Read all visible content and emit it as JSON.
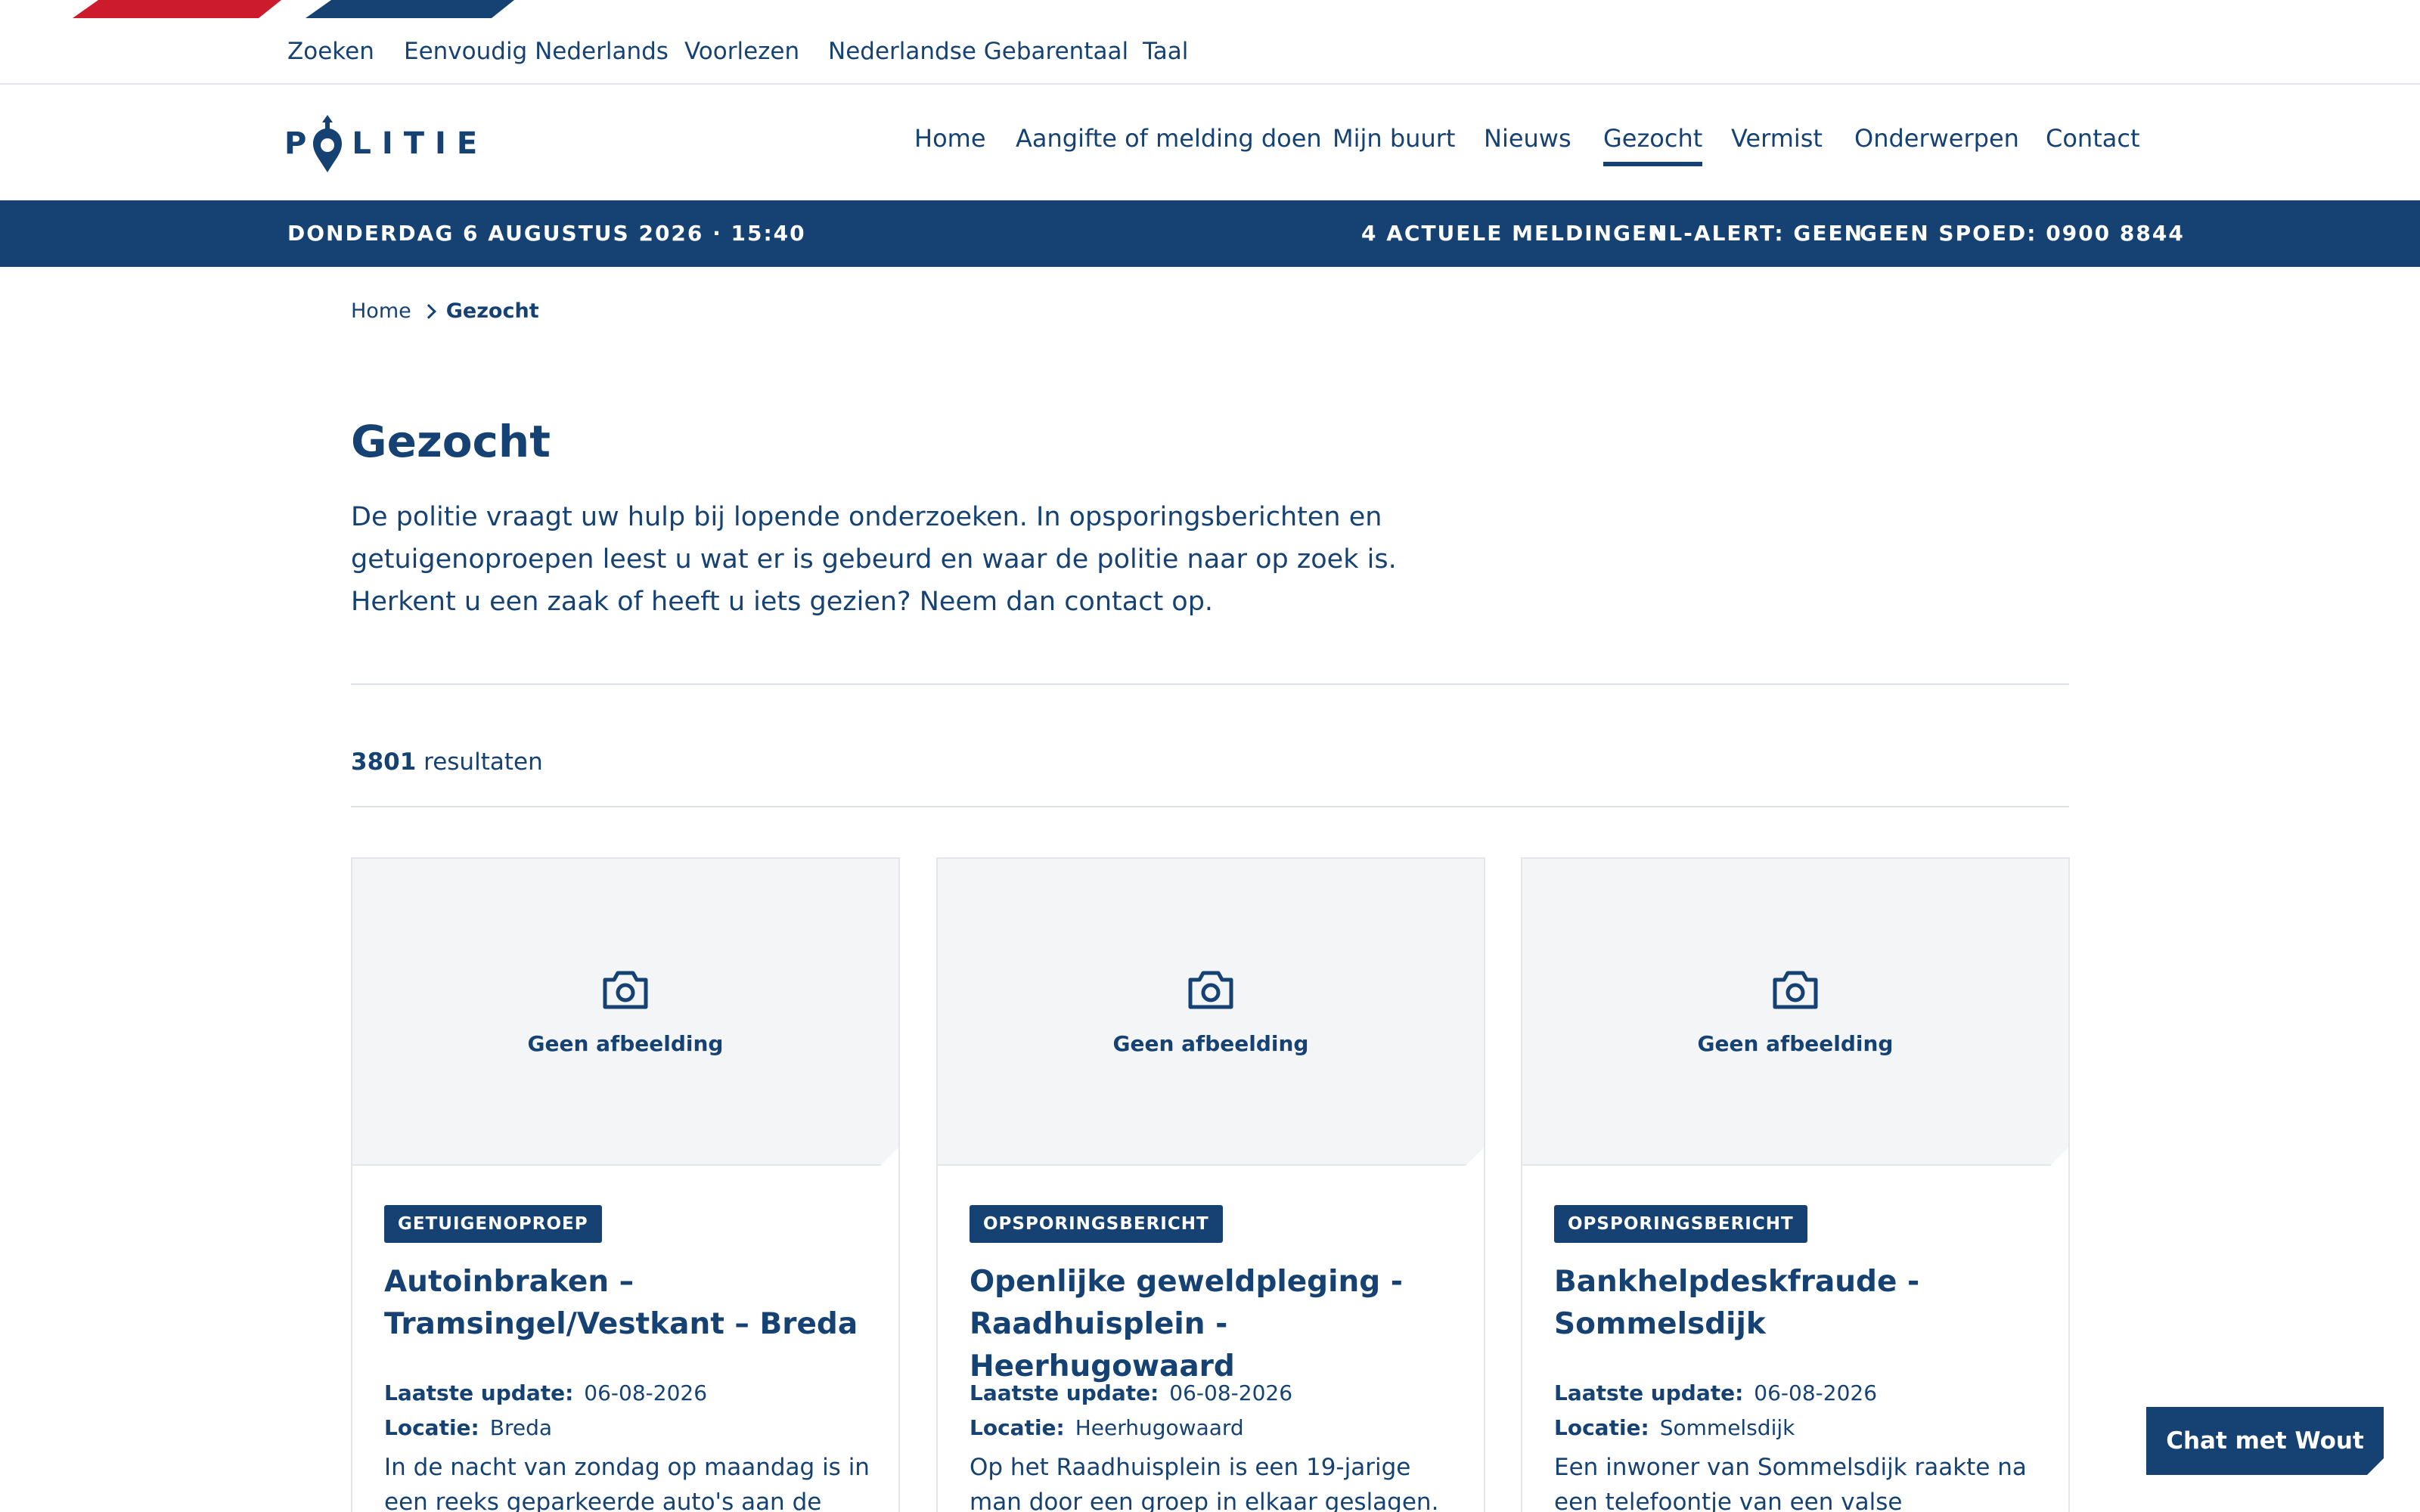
{
  "servicebar": {
    "items": [
      "Zoeken",
      "Eenvoudig Nederlands",
      "Voorlezen",
      "Nederlandse Gebarentaal",
      "Taal"
    ]
  },
  "logo": {
    "text": "LITIE",
    "letter_p": "P"
  },
  "nav": {
    "items": [
      "Home",
      "Aangifte of melding doen",
      "Mijn buurt",
      "Nieuws",
      "Gezocht",
      "Vermist",
      "Onderwerpen",
      "Contact"
    ],
    "active": "Gezocht"
  },
  "infobar": {
    "datetime": "DONDERDAG 6 AUGUSTUS 2026 · 15:40",
    "meldingen": "4 ACTUELE MELDINGEN",
    "nlalert": "NL-ALERT: GEEN",
    "geenspoed": "GEEN SPOED: 0900 8844"
  },
  "breadcrumb": {
    "home": "Home",
    "current": "Gezocht"
  },
  "page": {
    "title": "Gezocht",
    "intro": "De politie vraagt uw hulp bij lopende onderzoeken. In opsporingsberichten en getuigenoproepen leest u wat er is gebeurd en waar de politie naar op zoek is. Herkent u een zaak of heeft u iets gezien? Neem dan contact op."
  },
  "results": {
    "count": "3801",
    "label": "resultaten"
  },
  "cards": [
    {
      "no_image": "Geen afbeelding",
      "badge": "GETUIGENOPROEP",
      "title": "Autoinbraken – Tramsingel/Vestkant – Breda",
      "update_label": "Laatste update:",
      "update": "06-08-2026",
      "location_label": "Locatie:",
      "location": "Breda",
      "body": "In de nacht van zondag op maandag is in een reeks geparkeerde auto's aan de"
    },
    {
      "no_image": "Geen afbeelding",
      "badge": "OPSPORINGSBERICHT",
      "title": "Openlijke geweldpleging - Raadhuisplein - Heerhugowaard",
      "update_label": "Laatste update:",
      "update": "06-08-2026",
      "location_label": "Locatie:",
      "location": "Heerhugowaard",
      "body": "Op het Raadhuisplein is een 19-jarige man door een groep in elkaar geslagen. De politie"
    },
    {
      "no_image": "Geen afbeelding",
      "badge": "OPSPORINGSBERICHT",
      "title": "Bankhelpdeskfraude - Sommelsdijk",
      "update_label": "Laatste update:",
      "update": "06-08-2026",
      "location_label": "Locatie:",
      "location": "Sommelsdijk",
      "body": "Een inwoner van Sommelsdijk raakte na een telefoontje van een valse bankmedewerker"
    }
  ],
  "chat": {
    "label": "Chat met Wout"
  },
  "colors": {
    "primary": "#154273",
    "accent_red": "#cd1b2e",
    "card_bg": "#f4f5f7"
  }
}
